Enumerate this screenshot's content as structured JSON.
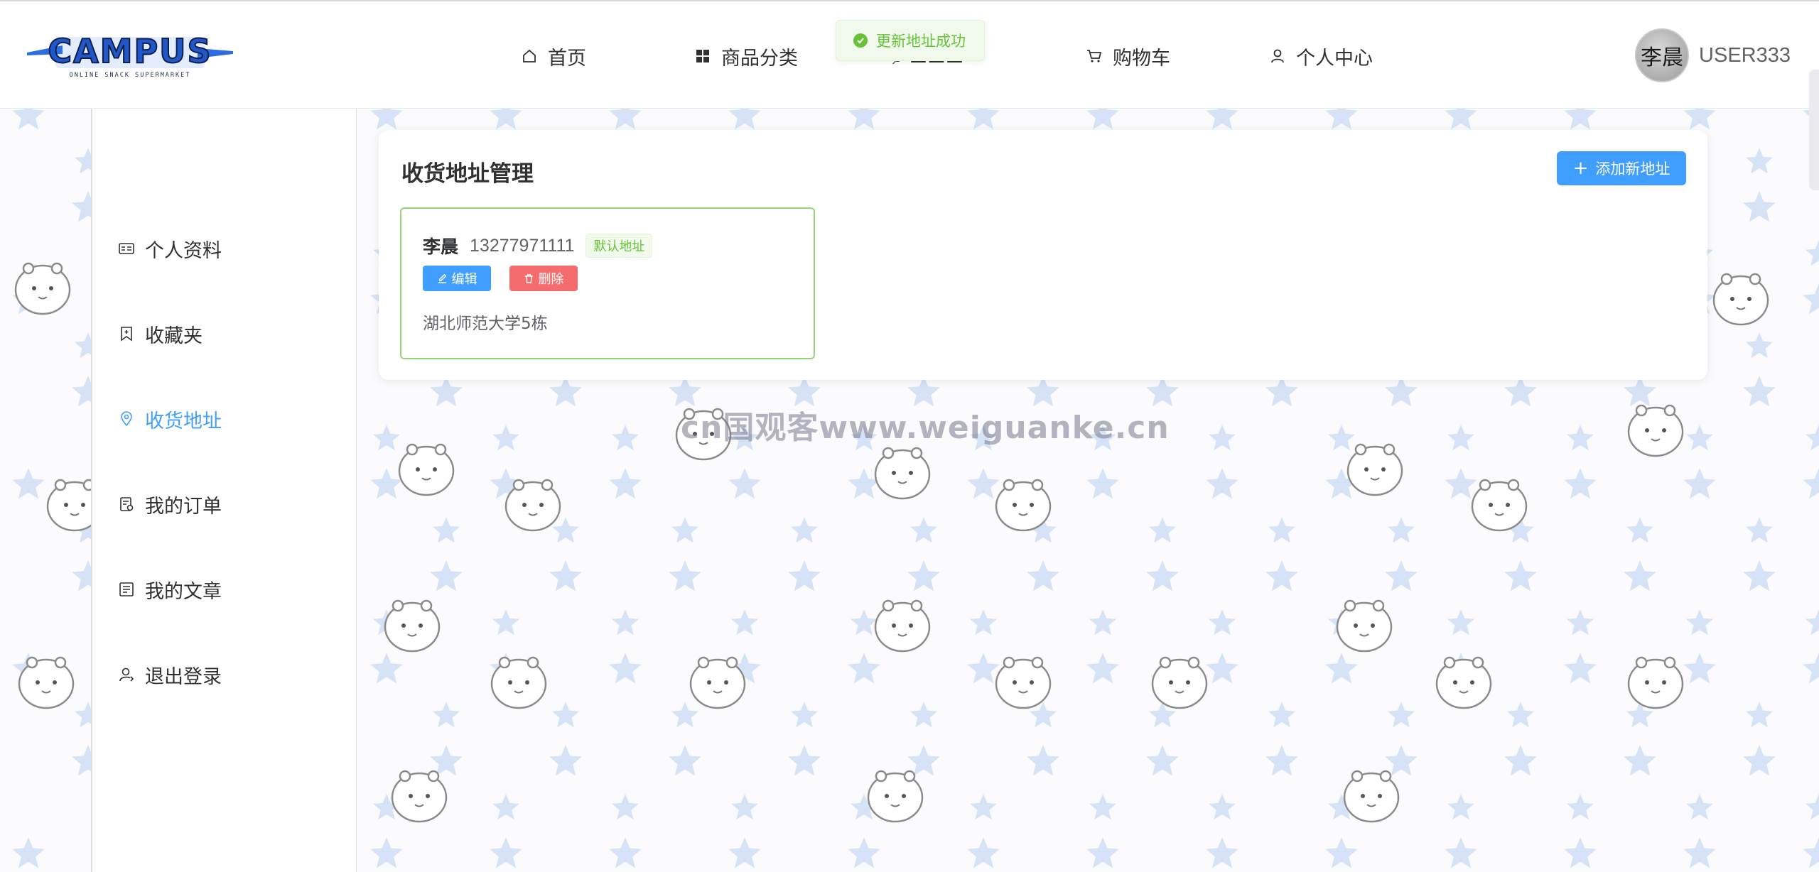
{
  "header": {
    "logo_text": "CAMPUS",
    "logo_subtext": "ONLINE SNACK SUPERMARKET",
    "nav": [
      {
        "label": "首页",
        "icon": "home-icon"
      },
      {
        "label": "商品分类",
        "icon": "grid-icon"
      },
      {
        "label": "购物车",
        "icon": "cart-icon"
      },
      {
        "label": "个人中心",
        "icon": "user-icon"
      }
    ],
    "user": {
      "avatar_text": "李晨",
      "name": "USER333"
    }
  },
  "toast": {
    "message": "更新地址成功",
    "icon": "check-circle-icon"
  },
  "sidebar": {
    "items": [
      {
        "label": "个人资料",
        "icon": "profile-card-icon",
        "active": false
      },
      {
        "label": "收藏夹",
        "icon": "bookmark-icon",
        "active": false
      },
      {
        "label": "收货地址",
        "icon": "location-icon",
        "active": true
      },
      {
        "label": "我的订单",
        "icon": "order-icon",
        "active": false
      },
      {
        "label": "我的文章",
        "icon": "article-icon",
        "active": false
      },
      {
        "label": "退出登录",
        "icon": "logout-icon",
        "active": false
      }
    ]
  },
  "main": {
    "title": "收货地址管理",
    "add_button": "添加新地址",
    "addresses": [
      {
        "name": "李晨",
        "phone": "13277971111",
        "badge": "默认地址",
        "edit_label": "编辑",
        "delete_label": "删除",
        "detail": "湖北师范大学5栋"
      }
    ]
  },
  "watermark": "cn国观客www.weiguanke.cn",
  "colors": {
    "primary": "#409eff",
    "success": "#67c23a",
    "danger": "#f56c6c",
    "star": "#d6e3f6"
  }
}
